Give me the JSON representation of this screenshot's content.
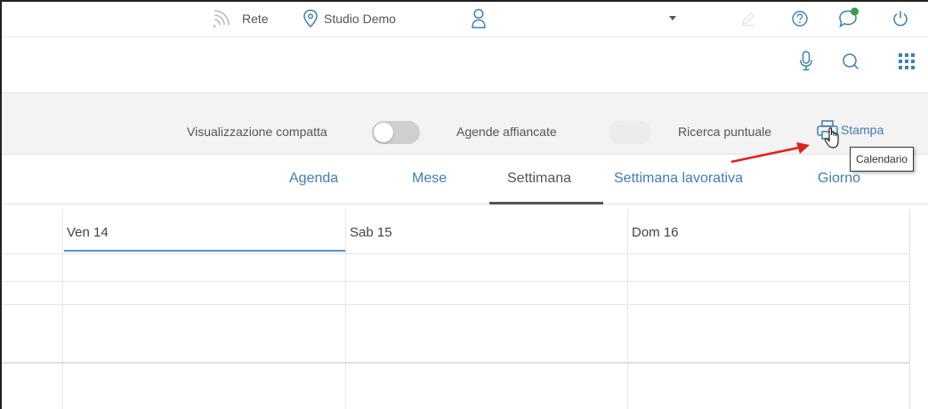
{
  "topbar": {
    "network_label": "Rete",
    "studio_label": "Studio Demo"
  },
  "toolbar": {
    "compact_view_label": "Visualizzazione compatta",
    "side_by_side_label": "Agende affiancate",
    "precise_search_label": "Ricerca puntuale",
    "print_label": "Stampa"
  },
  "tabs": [
    {
      "label": "Agenda"
    },
    {
      "label": "Mese"
    },
    {
      "label": "Settimana",
      "active": true
    },
    {
      "label": "Settimana lavorativa"
    },
    {
      "label": "Giorno"
    }
  ],
  "calendar": {
    "days": [
      "Ven 14",
      "Sab 15",
      "Dom 16"
    ]
  },
  "tooltip": {
    "text": "Calendario"
  },
  "colors": {
    "accent": "#3f7fb0",
    "annotation_arrow": "#e02020",
    "notification_badge": "#3c9a4a"
  }
}
